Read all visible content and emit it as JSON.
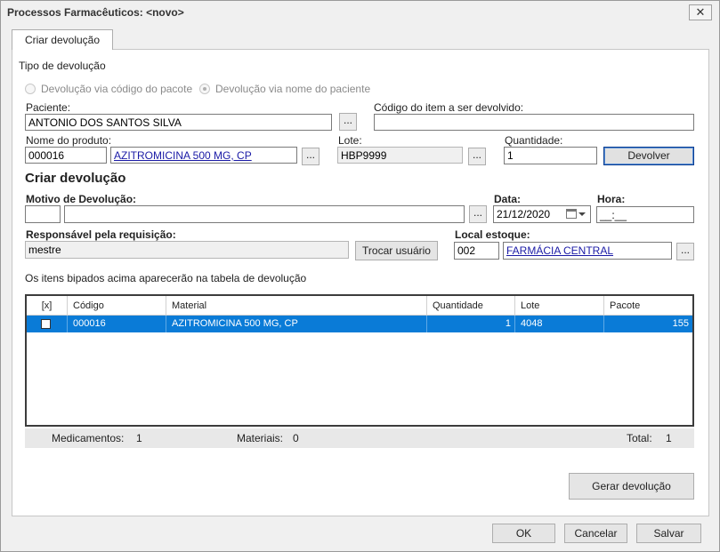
{
  "window": {
    "title": "Processos Farmacêuticos: <novo>",
    "close_glyph": "✕"
  },
  "tab": {
    "label": "Criar devolução"
  },
  "tipo": {
    "label": "Tipo de devolução",
    "options": [
      {
        "label": "Devolução via código do pacote",
        "selected": false
      },
      {
        "label": "Devolução via nome do paciente",
        "selected": true
      }
    ]
  },
  "paciente": {
    "label": "Paciente:",
    "value": "ANTONIO DOS SANTOS SILVA"
  },
  "codigo_item": {
    "label": "Código do item a ser devolvido:",
    "value": ""
  },
  "produto": {
    "label": "Nome do produto:",
    "code": "000016",
    "name": "AZITROMICINA 500 MG, CP"
  },
  "lote": {
    "label": "Lote:",
    "value": "HBP9999"
  },
  "quantidade": {
    "label": "Quantidade:",
    "value": "1"
  },
  "devolver_button": "Devolver",
  "dots_label": "...",
  "section_title": "Criar devolução",
  "motivo": {
    "label": "Motivo de Devolução:",
    "code": "",
    "description": ""
  },
  "data": {
    "label": "Data:",
    "value": "21/12/2020"
  },
  "hora": {
    "label": "Hora:",
    "value": "__:__"
  },
  "responsavel": {
    "label": "Responsável pela requisição:",
    "value": "mestre"
  },
  "trocar_usuario_button": "Trocar usuário",
  "local": {
    "label": "Local estoque:",
    "code": "002",
    "name": "FARMÁCIA CENTRAL"
  },
  "info_text": "Os itens bipados acima aparecerão na tabela de devolução",
  "table": {
    "headers": [
      "[x]",
      "Código",
      "Material",
      "Quantidade",
      "Lote",
      "Pacote"
    ],
    "rows": [
      {
        "checked": false,
        "codigo": "000016",
        "material": "AZITROMICINA 500 MG, CP",
        "quantidade": "1",
        "lote": "4048",
        "pacote": "155"
      }
    ]
  },
  "summary": {
    "medicamentos_label": "Medicamentos:",
    "medicamentos_value": "1",
    "materiais_label": "Materiais:",
    "materiais_value": "0",
    "total_label": "Total:",
    "total_value": "1"
  },
  "gerar_button": "Gerar devolução",
  "ok_button": "OK",
  "cancelar_button": "Cancelar",
  "salvar_button": "Salvar",
  "colors": {
    "selection": "#0a7bd7",
    "link": "#1a1aa6"
  }
}
